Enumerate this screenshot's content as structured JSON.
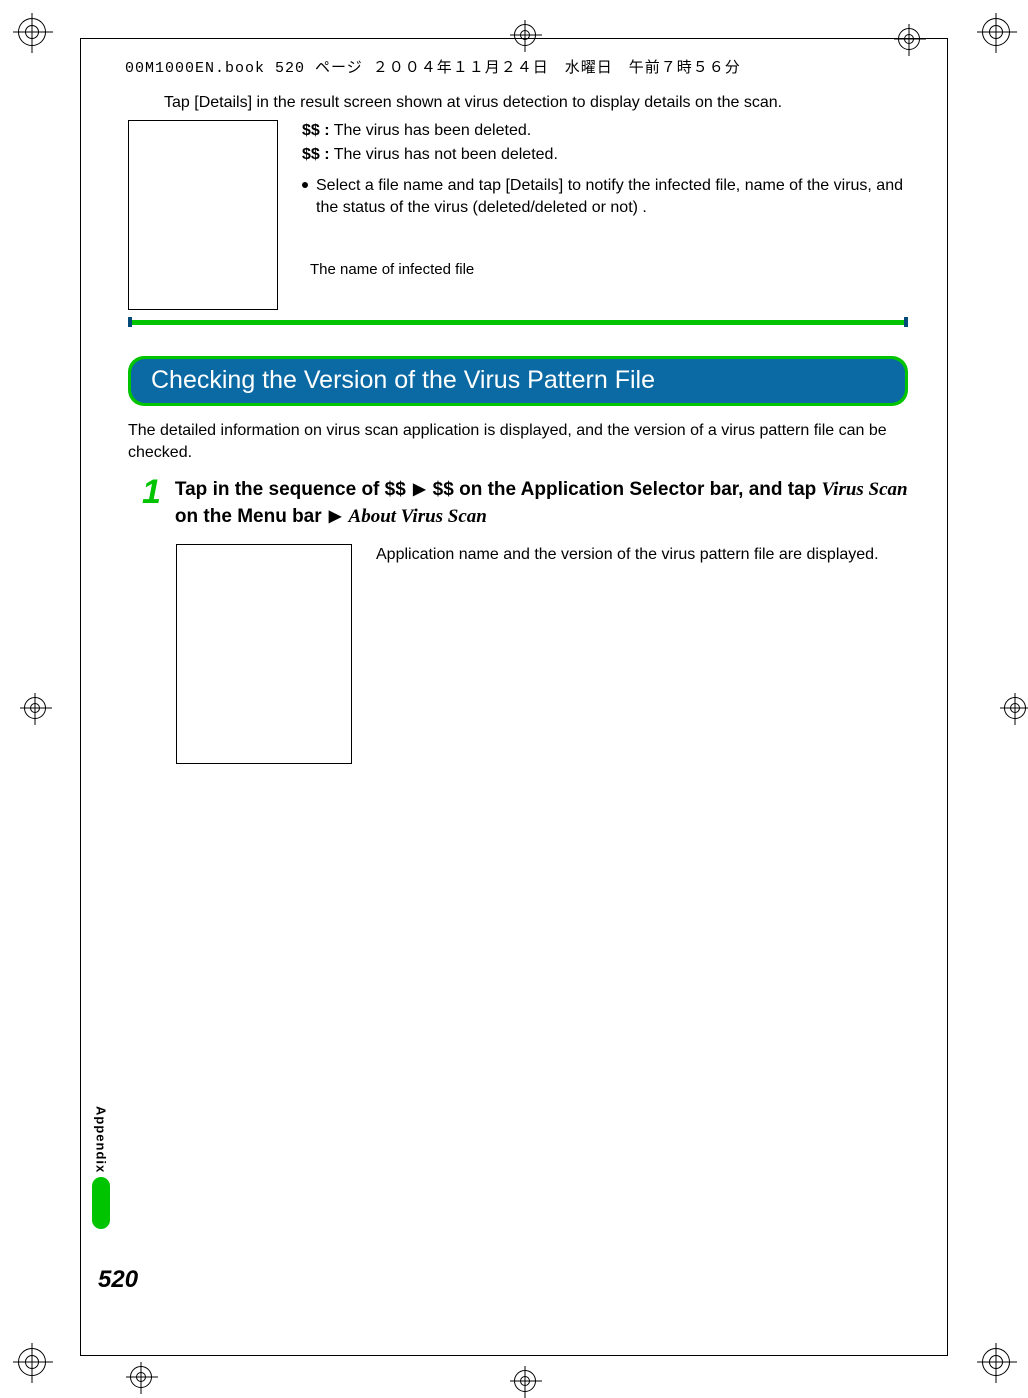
{
  "header": "00M1000EN.book  520 ページ  ２００４年１１月２４日　水曜日　午前７時５６分",
  "intro_top": "Tap [Details] in the result screen shown at virus detection to display details on the scan.",
  "def1": {
    "sym": "$$ :",
    "text": "The virus has been deleted."
  },
  "def2": {
    "sym": "$$ :",
    "text": "The virus has not been deleted."
  },
  "bullet1": "Select a file name and tap [Details] to notify the infected file, name of the virus, and the status of the virus (deleted/deleted or not) .",
  "caption1": "The name of infected file",
  "section_title": "Checking the Version of the Virus Pattern File",
  "section_intro": "The detailed information on virus scan application is displayed, and the version of a virus pattern file can be checked.",
  "step1": {
    "num": "1",
    "pre": "Tap in the sequence of $$ ",
    "mid": " $$ on the Application Selector bar, and tap ",
    "serif1": "Virus Scan",
    "post": " on the Menu bar ",
    "serif2": "About Virus Scan"
  },
  "result_desc": "Application name and the version of the virus pattern file are displayed.",
  "side_label": "Appendix",
  "page_number": "520"
}
